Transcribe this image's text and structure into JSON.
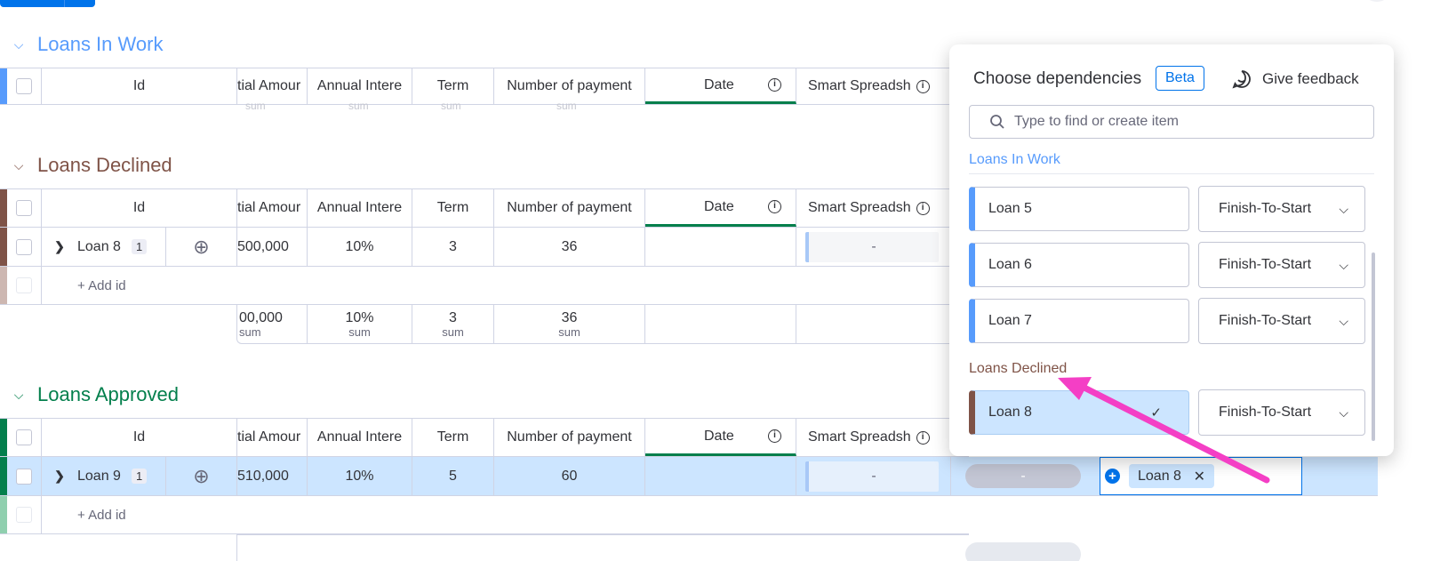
{
  "groups": {
    "in_work": {
      "title": "Loans In Work",
      "color": "#579bfc"
    },
    "declined": {
      "title": "Loans Declined",
      "color": "#7f5347"
    },
    "approved": {
      "title": "Loans Approved",
      "color": "#037f4c"
    }
  },
  "columns": {
    "id": "Id",
    "amount": "tial Amour",
    "rate": "Annual Intere",
    "term": "Term",
    "payments": "Number of payment",
    "date": "Date",
    "smart": "Smart Spreadsh"
  },
  "sum_label": "sum",
  "declined_row": {
    "name": "Loan 8",
    "count": "1",
    "amount": "500,000",
    "rate": "10%",
    "term": "3",
    "payments": "36",
    "smart": "-"
  },
  "declined_sum": {
    "amount": "00,000",
    "rate": "10%",
    "term": "3",
    "payments": "36"
  },
  "approved_row": {
    "name": "Loan 9",
    "count": "1",
    "amount": "510,000",
    "rate": "10%",
    "term": "5",
    "payments": "60",
    "smart": "-",
    "status": "-",
    "dependency": "Loan 8"
  },
  "add_id": "+ Add id",
  "panel": {
    "title": "Choose dependencies",
    "badge": "Beta",
    "feedback": "Give feedback",
    "search_placeholder": "Type to find or create item",
    "groups": [
      {
        "label": "Loans In Work",
        "color": "#579bfc",
        "items": [
          {
            "name": "Loan 5",
            "type": "Finish-To-Start"
          },
          {
            "name": "Loan 6",
            "type": "Finish-To-Start"
          },
          {
            "name": "Loan 7",
            "type": "Finish-To-Start"
          }
        ]
      },
      {
        "label": "Loans Declined",
        "color": "#7f5347",
        "items": [
          {
            "name": "Loan 8",
            "type": "Finish-To-Start",
            "selected": true
          }
        ]
      }
    ]
  },
  "annotation_color": "#f43fc5"
}
